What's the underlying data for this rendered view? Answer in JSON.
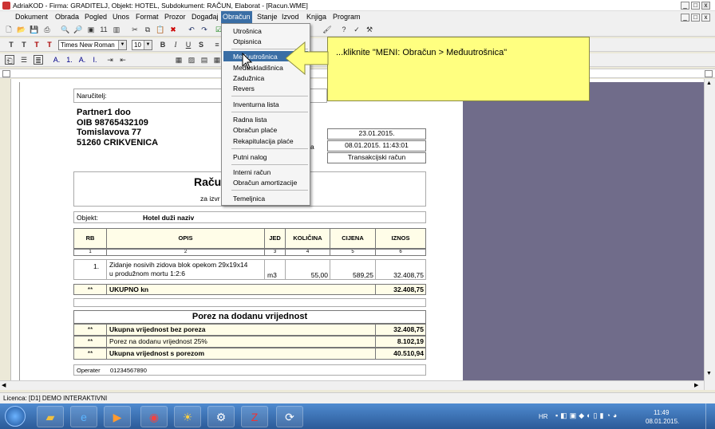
{
  "window": {
    "title": "AdriaKOD - Firma: GRADITELJ,   Objekt: HOTEL,   Subdokument: RAČUN,  Elaborat - [Racun.WME]"
  },
  "menu": [
    "Dokument",
    "Obrada",
    "Pogled",
    "Unos",
    "Format",
    "Prozor",
    "Događaj",
    "Obračun",
    "Stanje",
    "Izvod",
    "Knjiga",
    "Program"
  ],
  "toolbar": {
    "font_name": "Times New Roman",
    "font_size": "10",
    "ttt": [
      "T",
      "T",
      "T",
      "T"
    ],
    "bold": "B",
    "italic": "I",
    "underline": "U",
    "strike": "S",
    "char_a": [
      "A.",
      "1.",
      "A.",
      "I."
    ]
  },
  "dropdown": {
    "items": [
      "Utrošnica",
      "Otpisnica",
      "Međuutrošnica",
      "Međuskladišnica",
      "Zadužnica",
      "Revers",
      "Inventurna lista",
      "Radna lista",
      "Obračun plaće",
      "Rekapitulacija plaće",
      "Putni nalog",
      "Interni račun",
      "Obračun amortizacije",
      "Temeljnica"
    ],
    "selected": "Međuutrošnica"
  },
  "callout": {
    "text": "...kliknite \"MENI: Obračun > Međuutrošnica\""
  },
  "doc": {
    "narucitelj_label": "Naručitelj:",
    "company": [
      "Partner1 doo",
      "OIB 98765432109",
      "Tomislavova 77",
      "51260 CRIKVENICA"
    ],
    "date1": "23.01.2015.",
    "date2": "08.01.2015. 11:43:01",
    "date2_lbl": "a",
    "racun_type": "Transakcijski račun",
    "title": "Raču",
    "subtitle": "za izvr",
    "objekt_label": "Objekt:",
    "objekt_value": "Hotel duži naziv",
    "headers": [
      "RB",
      "OPIS",
      "JED",
      "KOLIČINA",
      "CIJENA",
      "IZNOS"
    ],
    "header_nums": [
      "1",
      "2",
      "3",
      "4",
      "5",
      "6"
    ],
    "row": {
      "rb": "1.",
      "opis1": "Zidanje nosivih zidova blok opekom 29x19x14",
      "opis2": "u produžnom mortu 1:2:6",
      "jed": "m3",
      "kolicina": "55,00",
      "cijena": "589,25",
      "iznos": "32.408,75"
    },
    "total_mark": "**",
    "total_label": "UKUPNO kn",
    "total_value": "32.408,75",
    "pdv_title": "Porez na dodanu vrijednost",
    "pdv_rows": [
      {
        "mark": "**",
        "label": "Ukupna vrijednost bez poreza",
        "value": "32.408,75"
      },
      {
        "mark": "**",
        "label": "Porez na dodanu vrijednost 25%",
        "value": "8.102,19"
      },
      {
        "mark": "**",
        "label": "Ukupna vrijednost s porezom",
        "value": "40.510,94"
      }
    ],
    "operater_label": "Operater",
    "operater_value": "01234567890"
  },
  "status": {
    "licence": "Licenca: [D1] DEMO INTERAKTIVNI"
  },
  "taskbar": {
    "lang": "HR",
    "time": "11:49",
    "date": "08.01.2015."
  }
}
